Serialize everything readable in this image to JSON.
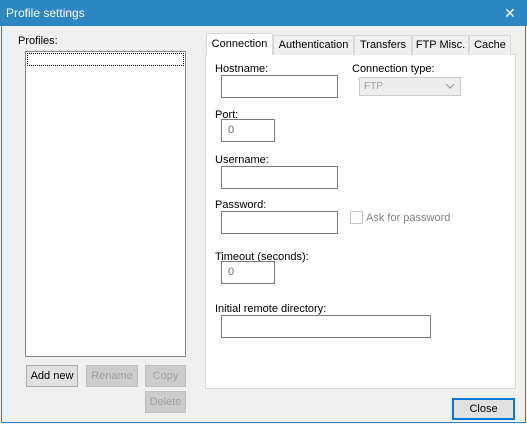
{
  "window": {
    "title": "Profile settings",
    "close_glyph": "✕"
  },
  "profiles": {
    "label": "Profiles:",
    "items": []
  },
  "buttons": {
    "add_new": "Add new",
    "rename": "Rename",
    "copy": "Copy",
    "delete": "Delete",
    "close": "Close"
  },
  "tabs": [
    {
      "label": "Connection",
      "active": true
    },
    {
      "label": "Authentication",
      "active": false
    },
    {
      "label": "Transfers",
      "active": false
    },
    {
      "label": "FTP Misc.",
      "active": false
    },
    {
      "label": "Cache",
      "active": false
    }
  ],
  "connection": {
    "hostname": {
      "label": "Hostname:",
      "value": ""
    },
    "connection_type": {
      "label": "Connection type:",
      "value": "FTP",
      "enabled": false
    },
    "port": {
      "label": "Port:",
      "value": "0"
    },
    "username": {
      "label": "Username:",
      "value": ""
    },
    "password": {
      "label": "Password:",
      "value": ""
    },
    "ask_for_password": {
      "label": "Ask for password",
      "checked": false,
      "enabled": false
    },
    "timeout": {
      "label": "Timeout (seconds):",
      "value": "0"
    },
    "initial_remote_directory": {
      "label": "Initial remote directory:",
      "value": ""
    }
  },
  "icons": {
    "close": "close-icon",
    "dropdown": "chevron-down-icon"
  }
}
